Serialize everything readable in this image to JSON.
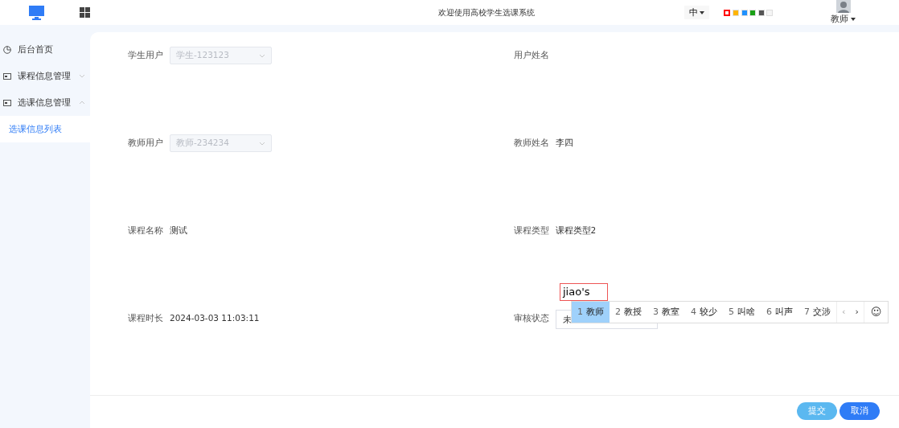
{
  "header": {
    "title": "欢迎使用高校学生选课系统",
    "language": "中",
    "themes": [
      {
        "color": "#ff0000",
        "selected": true
      },
      {
        "color": "#ffb400",
        "selected": false
      },
      {
        "color": "#1e90ff",
        "selected": false
      },
      {
        "color": "#19a015",
        "selected": false
      },
      {
        "color": "#555555",
        "selected": false
      },
      {
        "color": "#f5f5f5",
        "selected": false
      }
    ],
    "user": "教师"
  },
  "sidebar": {
    "items": [
      {
        "label": "后台首页",
        "selected": false
      },
      {
        "label": "课程信息管理",
        "expanded": false,
        "selected": false
      },
      {
        "label": "选课信息管理",
        "expanded": true,
        "selected": false,
        "children": [
          {
            "label": "选课信息列表",
            "selected": true
          }
        ]
      }
    ]
  },
  "form": {
    "fields": [
      {
        "label": "学生用户",
        "kind": "select",
        "value": "学生-123123",
        "disabled": true
      },
      {
        "label": "用户姓名",
        "kind": "text"
      },
      {
        "label": "教师用户",
        "kind": "select",
        "value": "教师-234234",
        "disabled": true
      },
      {
        "label": "教师姓名",
        "kind": "text",
        "value": "李四"
      },
      {
        "label": "课程名称",
        "kind": "text",
        "value": "测试"
      },
      {
        "label": "课程类型",
        "kind": "text",
        "value": "课程类型2"
      },
      {
        "label": "课程时长",
        "kind": "text",
        "value": "2024-03-03 11:03:11"
      },
      {
        "label": "审核状态",
        "kind": "input",
        "value": "未"
      }
    ],
    "buttons": [
      {
        "label": "提交",
        "kind": "light"
      },
      {
        "label": "取消",
        "kind": "primary"
      }
    ]
  },
  "ime": {
    "composition": "jiao's",
    "candidates": [
      {
        "index": "1",
        "text": "教师",
        "selected": true
      },
      {
        "index": "2",
        "text": "教授",
        "selected": false
      },
      {
        "index": "3",
        "text": "教室",
        "selected": false
      },
      {
        "index": "4",
        "text": "较少",
        "selected": false
      },
      {
        "index": "5",
        "text": "叫啥",
        "selected": false
      },
      {
        "index": "6",
        "text": "叫声",
        "selected": false
      },
      {
        "index": "7",
        "text": "交涉",
        "selected": false
      }
    ],
    "prev": "‹",
    "next": "›",
    "emoji": "☺"
  }
}
